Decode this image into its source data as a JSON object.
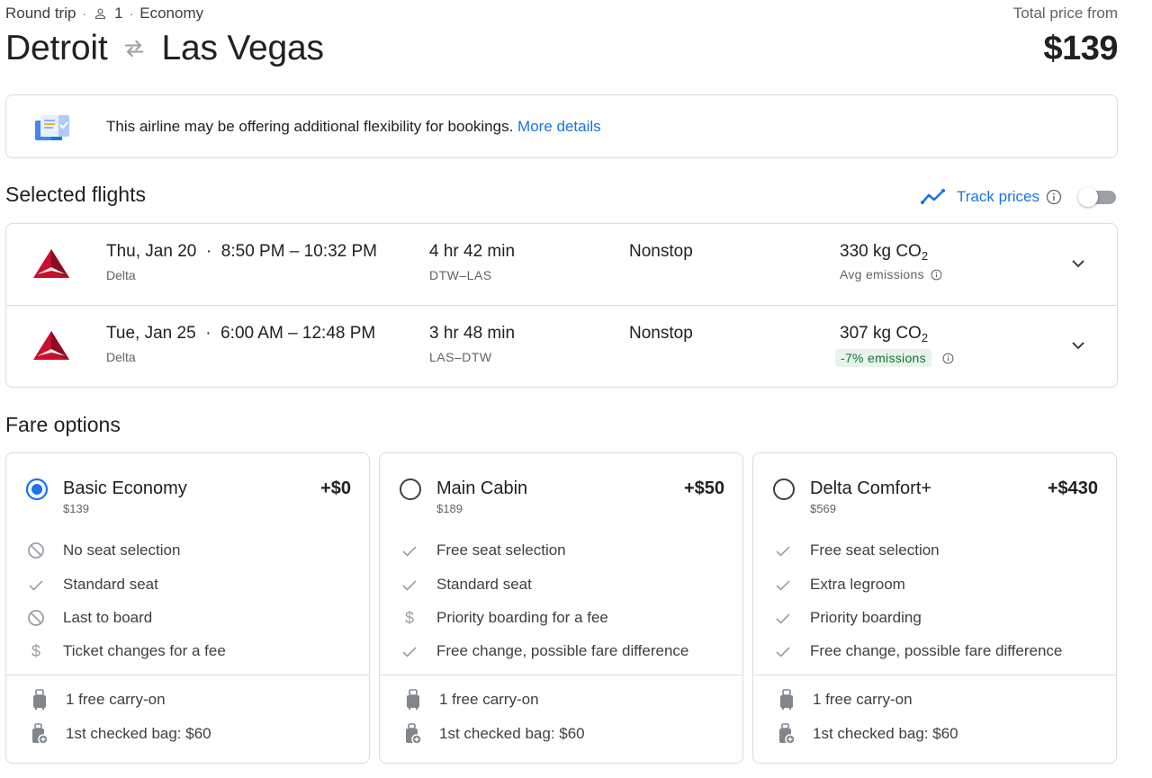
{
  "header": {
    "trip_type": "Round trip",
    "passengers": "1",
    "cabin_class": "Economy",
    "origin": "Detroit",
    "destination": "Las Vegas",
    "price_label": "Total price from",
    "price": "$139"
  },
  "banner": {
    "text": "This airline may be offering additional flexibility for bookings.",
    "link": "More details"
  },
  "selected_flights": {
    "title": "Selected flights",
    "track_prices_label": "Track prices",
    "track_prices_enabled": false,
    "flights": [
      {
        "date": "Thu, Jan 20",
        "times": "8:50 PM – 10:32 PM",
        "airline": "Delta",
        "duration": "4 hr 42 min",
        "airports": "DTW–LAS",
        "stops": "Nonstop",
        "co2_value": "330 kg CO",
        "co2_sub": "2",
        "emissions_label": "Avg emissions"
      },
      {
        "date": "Tue, Jan 25",
        "times": "6:00 AM – 12:48 PM",
        "airline": "Delta",
        "duration": "3 hr 48 min",
        "airports": "LAS–DTW",
        "stops": "Nonstop",
        "co2_value": "307 kg CO",
        "co2_sub": "2",
        "emissions_label": "-7% emissions"
      }
    ]
  },
  "fare_options": {
    "title": "Fare options",
    "cards": [
      {
        "name": "Basic Economy",
        "total": "$139",
        "delta": "+$0",
        "selected": true,
        "features": [
          {
            "icon": "block-icon",
            "text": "No seat selection"
          },
          {
            "icon": "check-icon",
            "text": "Standard seat"
          },
          {
            "icon": "block-icon",
            "text": "Last to board"
          },
          {
            "icon": "dollar-icon",
            "text": "Ticket changes for a fee"
          }
        ],
        "bags": [
          {
            "icon": "carry-on-bag-icon",
            "text": "1 free carry-on"
          },
          {
            "icon": "checked-bag-icon",
            "text": "1st checked bag: $60"
          }
        ]
      },
      {
        "name": "Main Cabin",
        "total": "$189",
        "delta": "+$50",
        "selected": false,
        "features": [
          {
            "icon": "check-icon",
            "text": "Free seat selection"
          },
          {
            "icon": "check-icon",
            "text": "Standard seat"
          },
          {
            "icon": "dollar-icon",
            "text": "Priority boarding for a fee"
          },
          {
            "icon": "check-icon",
            "text": "Free change, possible fare difference"
          }
        ],
        "bags": [
          {
            "icon": "carry-on-bag-icon",
            "text": "1 free carry-on"
          },
          {
            "icon": "checked-bag-icon",
            "text": "1st checked bag: $60"
          }
        ]
      },
      {
        "name": "Delta Comfort+",
        "total": "$569",
        "delta": "+$430",
        "selected": false,
        "features": [
          {
            "icon": "check-icon",
            "text": "Free seat selection"
          },
          {
            "icon": "check-icon",
            "text": "Extra legroom"
          },
          {
            "icon": "check-icon",
            "text": "Priority boarding"
          },
          {
            "icon": "check-icon",
            "text": "Free change, possible fare difference"
          }
        ],
        "bags": [
          {
            "icon": "carry-on-bag-icon",
            "text": "1 free carry-on"
          },
          {
            "icon": "checked-bag-icon",
            "text": "1st checked bag: $60"
          }
        ]
      }
    ]
  },
  "colors": {
    "accent": "#1a73e8",
    "text": "#202124",
    "secondary_text": "#5f6368",
    "border": "#dadce0",
    "delta_red": "#c8102e",
    "emissions_good_bg": "#e6f4ea",
    "emissions_good_text": "#137333"
  }
}
